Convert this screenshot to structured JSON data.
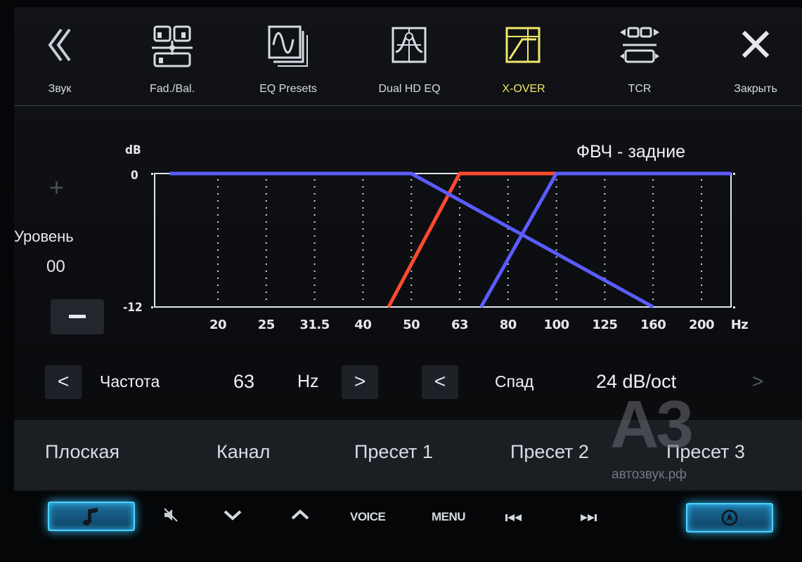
{
  "toolbar": {
    "items": [
      {
        "label": "Звук",
        "icon": "double-chevron-left-icon"
      },
      {
        "label": "Fad./Bal.",
        "icon": "fader-balance-icon"
      },
      {
        "label": "EQ Presets",
        "icon": "eq-presets-icon"
      },
      {
        "label": "Dual HD EQ",
        "icon": "dual-hd-eq-icon"
      },
      {
        "label": "X-OVER",
        "icon": "crossover-icon",
        "active": true
      },
      {
        "label": "TCR",
        "icon": "tcr-icon"
      },
      {
        "label": "Закрыть",
        "icon": "close-icon"
      }
    ],
    "active_color": "#f2e86a"
  },
  "chart": {
    "title": "ФВЧ - задние",
    "y_unit": "dB",
    "y_top": "0",
    "y_bottom": "-12",
    "x_unit": "Hz"
  },
  "chart_data": {
    "type": "line",
    "title": "ФВЧ - задние",
    "ylabel": "dB",
    "xlabel": "Hz",
    "categories": [
      "20",
      "25",
      "31.5",
      "40",
      "50",
      "63",
      "80",
      "100",
      "125",
      "160",
      "200"
    ],
    "ylim": [
      -12,
      0
    ],
    "series": [
      {
        "color": "#ff4b2e",
        "points": [
          [
            45,
            -12
          ],
          [
            63,
            0
          ],
          [
            200,
            0
          ]
        ]
      },
      {
        "color": "#5a5cff",
        "points": [
          [
            16,
            0
          ],
          [
            50,
            0
          ],
          [
            160,
            -12
          ]
        ]
      },
      {
        "color": "#5a5cff",
        "points": [
          [
            70,
            -12
          ],
          [
            100,
            0
          ],
          [
            250,
            0
          ]
        ]
      }
    ],
    "grid": true
  },
  "level": {
    "plus": "+",
    "label": "Уровень",
    "value": "00"
  },
  "params": {
    "freq_label": "Частота",
    "freq_value": "63",
    "freq_unit": "Hz",
    "slope_label": "Спад",
    "slope_value": "24 dB/oct",
    "prev": "<",
    "next": ">"
  },
  "presets": [
    "Плоская",
    "Канал",
    "Пресет 1",
    "Пресет 2",
    "Пресет 3"
  ],
  "watermark": {
    "big": "A3",
    "small": "автозвук.рф"
  },
  "hard_buttons": {
    "voice": "VOICE",
    "menu": "MENU"
  },
  "colors": {
    "red_curve": "#ff4b2e",
    "blue_curve": "#5a5cff",
    "grid_frame": "#dfe6f3",
    "glow": "#2fb5f0"
  }
}
